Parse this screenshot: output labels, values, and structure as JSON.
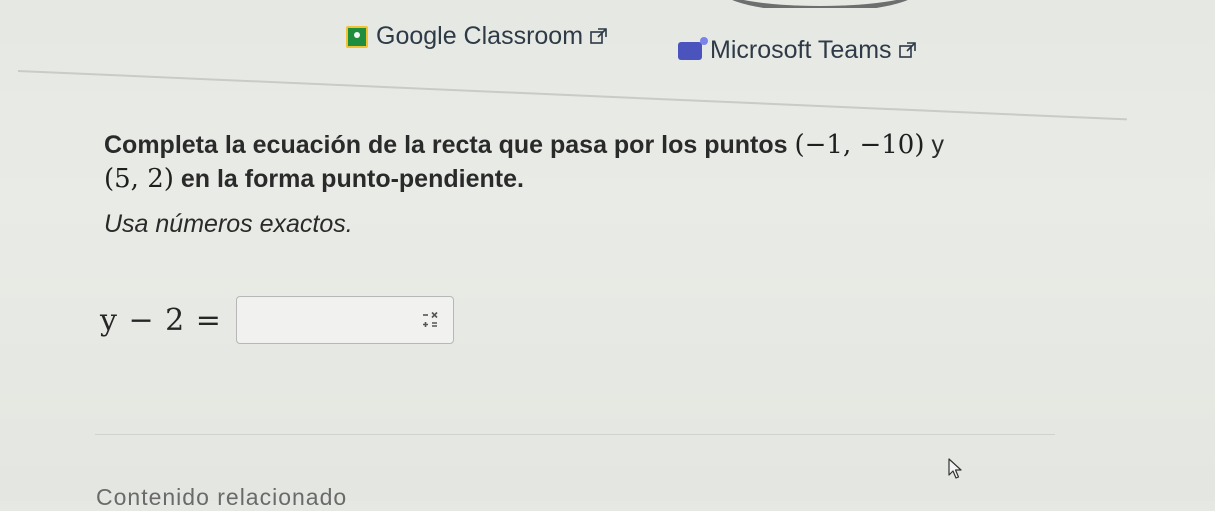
{
  "share": {
    "classroom_label": "Google Classroom",
    "classroom_icon": "google-classroom-icon",
    "teams_label": "Microsoft Teams",
    "teams_icon": "microsoft-teams-icon",
    "external_icon": "external-link-icon"
  },
  "question": {
    "text_before": "Completa la ecuación de la recta que pasa por los puntos",
    "point1": "(−1, −10)",
    "connector": "y",
    "point2": "(5, 2)",
    "text_after": "en la forma punto-pendiente."
  },
  "instructions": "Usa números exactos.",
  "equation": {
    "lhs": "y − 2 =",
    "answer_value": "",
    "keypad_icon": "math-keypad-icon"
  },
  "footer": {
    "related_label": "Contenido relacionado"
  },
  "colors": {
    "background": "#e8eae5",
    "classroom_green": "#1e8e3e",
    "teams_purple": "#4b53bc"
  }
}
